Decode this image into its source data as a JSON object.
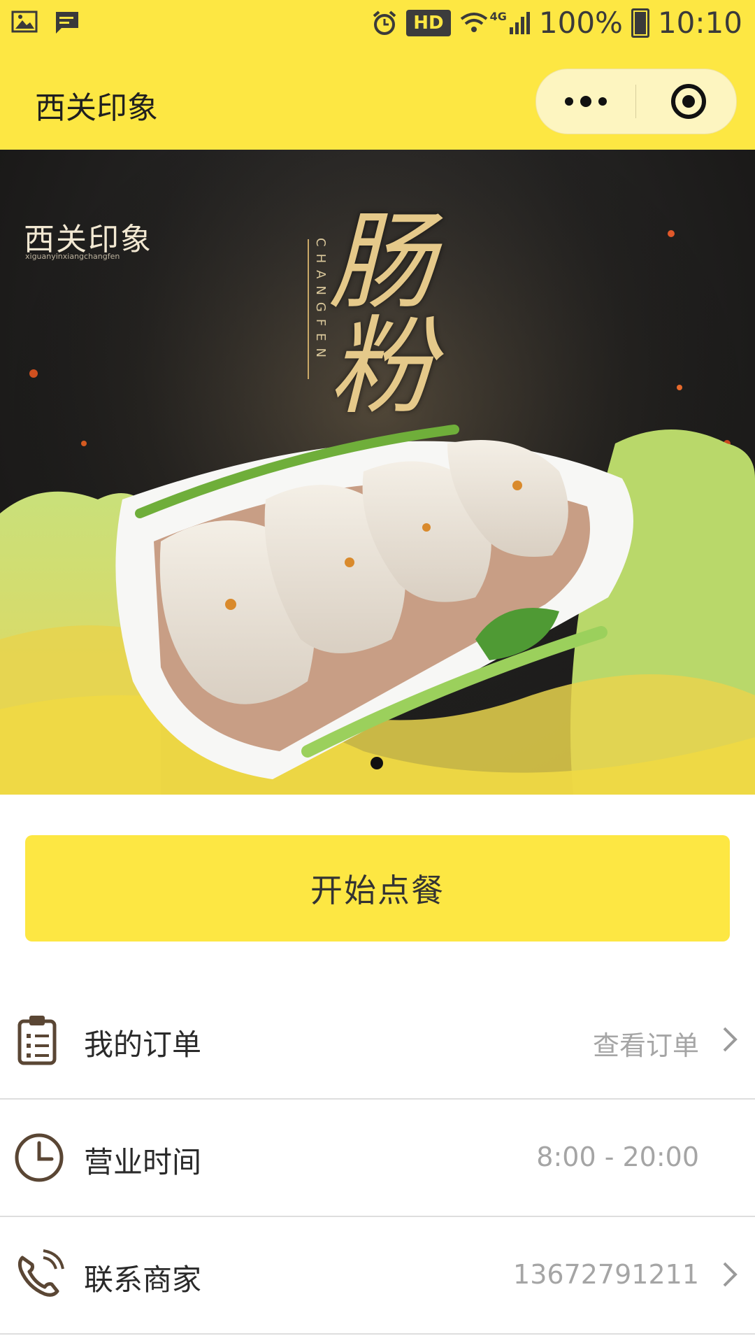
{
  "status_bar": {
    "hd": "HD",
    "network": "4G",
    "battery": "100%",
    "time": "10:10"
  },
  "nav": {
    "title": "西关印象"
  },
  "banner": {
    "brand": "西关印象",
    "brand_sub": "xiguanyinxiangchangfen",
    "pinyin": "CHANGFEN",
    "calligraphy": "肠粉",
    "active_slide": 1,
    "slide_count": 1
  },
  "order_button": {
    "label": "开始点餐"
  },
  "rows": {
    "orders": {
      "label": "我的订单",
      "value": "查看订单"
    },
    "hours": {
      "label": "营业时间",
      "value": "8:00 - 20:00"
    },
    "contact": {
      "label": "联系商家",
      "value": "13672791211"
    }
  },
  "colors": {
    "accent": "#fde743",
    "icon": "#5a4634",
    "muted_text": "#a5a5a5"
  }
}
